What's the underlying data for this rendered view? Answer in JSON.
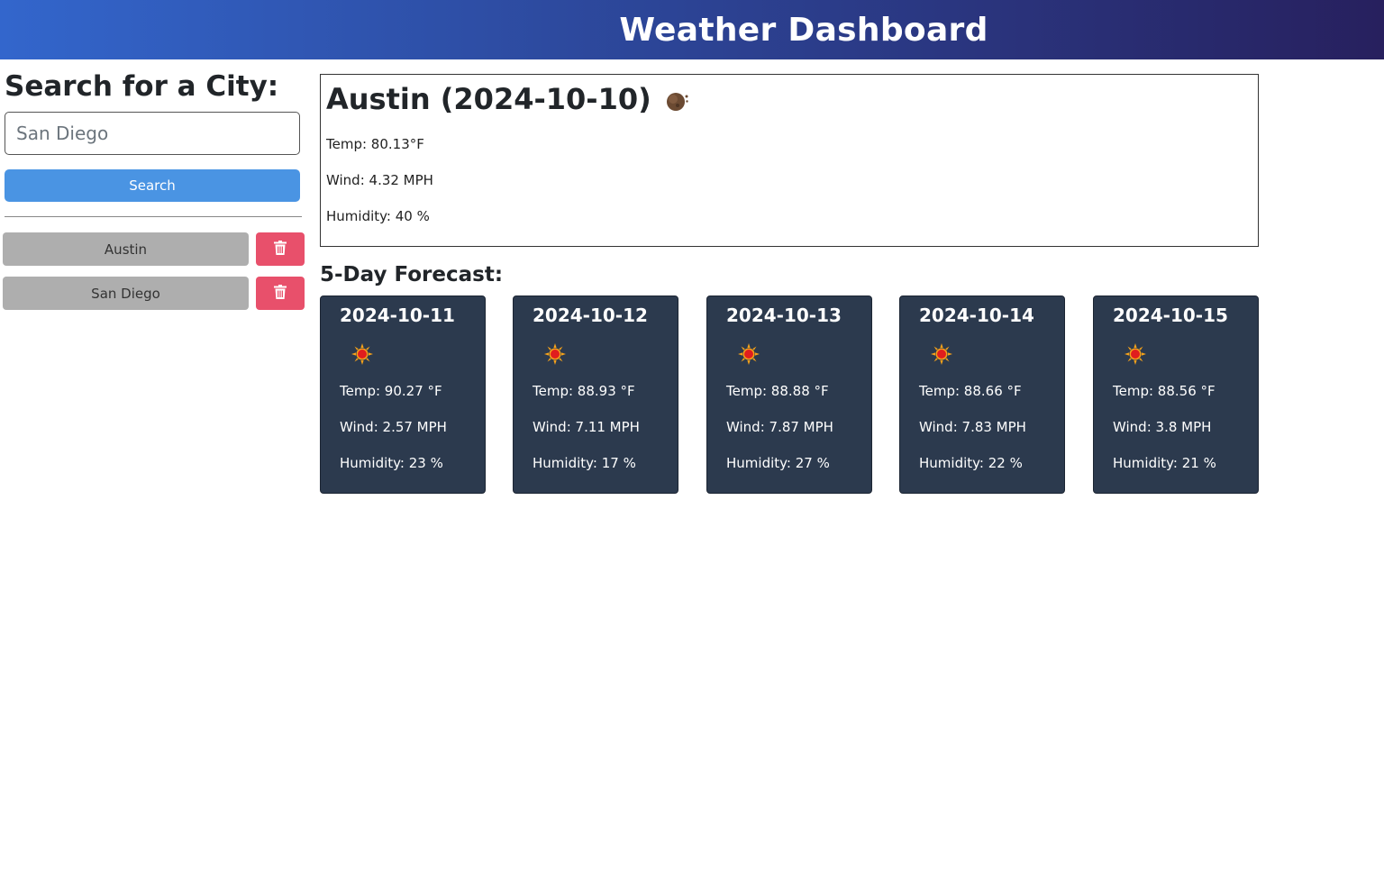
{
  "header": {
    "title": "Weather Dashboard"
  },
  "search": {
    "heading": "Search for a City:",
    "value": "San Diego",
    "placeholder": "San Diego",
    "button_label": "Search"
  },
  "history": [
    {
      "city": "Austin"
    },
    {
      "city": "San Diego"
    }
  ],
  "current": {
    "title": "Austin (2024-10-10)",
    "icon": "moon-icon",
    "temp": "Temp: 80.13°F",
    "wind": "Wind: 4.32 MPH",
    "humidity": "Humidity: 40 %"
  },
  "forecast": {
    "heading": "5-Day Forecast:",
    "days": [
      {
        "date": "2024-10-11",
        "icon": "sun-icon",
        "temp": "Temp: 90.27 °F",
        "wind": "Wind: 2.57 MPH",
        "humidity": "Humidity: 23 %"
      },
      {
        "date": "2024-10-12",
        "icon": "sun-icon",
        "temp": "Temp: 88.93 °F",
        "wind": "Wind: 7.11 MPH",
        "humidity": "Humidity: 17 %"
      },
      {
        "date": "2024-10-13",
        "icon": "sun-icon",
        "temp": "Temp: 88.88 °F",
        "wind": "Wind: 7.87 MPH",
        "humidity": "Humidity: 27 %"
      },
      {
        "date": "2024-10-14",
        "icon": "sun-icon",
        "temp": "Temp: 88.66 °F",
        "wind": "Wind: 7.83 MPH",
        "humidity": "Humidity: 22 %"
      },
      {
        "date": "2024-10-15",
        "icon": "sun-icon",
        "temp": "Temp: 88.56 °F",
        "wind": "Wind: 3.8 MPH",
        "humidity": "Humidity: 21 %"
      }
    ]
  },
  "colors": {
    "header_start": "#3366cc",
    "header_end": "#27205e",
    "search_button": "#4a94e3",
    "history_button": "#aeaeae",
    "delete_button": "#e8506b",
    "card_background": "#2c3a4e"
  }
}
